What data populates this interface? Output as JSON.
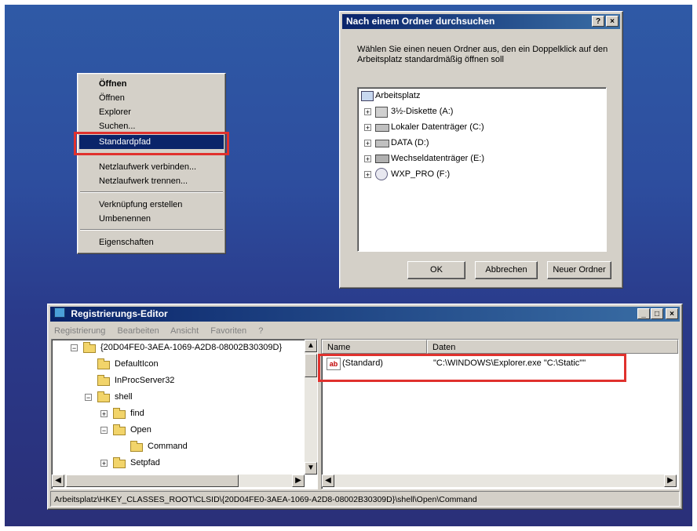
{
  "context_menu": {
    "items": [
      "Öffnen",
      "Öffnen",
      "Explorer",
      "Suchen...",
      "Standardpfad",
      "Netzlaufwerk verbinden...",
      "Netzlaufwerk trennen...",
      "Verknüpfung erstellen",
      "Umbenennen",
      "Eigenschaften"
    ],
    "selected": "Standardpfad"
  },
  "browse_dialog": {
    "title": "Nach einem Ordner durchsuchen",
    "title_buttons": [
      "?",
      "×"
    ],
    "description": "Wählen Sie einen neuen Ordner aus, den ein Doppelklick auf den Arbeitsplatz standardmäßig öffnen soll",
    "tree_root": "Arbeitsplatz",
    "tree_items": [
      "3½-Diskette (A:)",
      "Lokaler Datenträger (C:)",
      "DATA (D:)",
      "Wechseldatenträger (E:)",
      "WXP_PRO (F:)"
    ],
    "buttons": {
      "ok": "OK",
      "cancel": "Abbrechen",
      "new_folder": "Neuer Ordner"
    }
  },
  "registry_editor": {
    "title": "Registrierungs-Editor",
    "window_buttons": [
      "_",
      "□",
      "×"
    ],
    "menu": [
      "Registrierung",
      "Bearbeiten",
      "Ansicht",
      "Favoriten",
      "?"
    ],
    "tree": [
      "{20D04FE0-3AEA-1069-A2D8-08002B30309D}",
      "DefaultIcon",
      "InProcServer32",
      "shell",
      "find",
      "Open",
      "Command",
      "Setpfad"
    ],
    "columns": {
      "name": "Name",
      "data": "Daten"
    },
    "row": {
      "name": "(Standard)",
      "value_icon": "ab",
      "data": "\"C:\\WINDOWS\\Explorer.exe \"C:\\Static\"\""
    },
    "status": "Arbeitsplatz\\HKEY_CLASSES_ROOT\\CLSID\\{20D04FE0-3AEA-1069-A2D8-08002B30309D}\\shell\\Open\\Command"
  },
  "colors": {
    "highlight": "#e0312d",
    "titlebar": "#0a246a",
    "selection": "#0a246a"
  }
}
